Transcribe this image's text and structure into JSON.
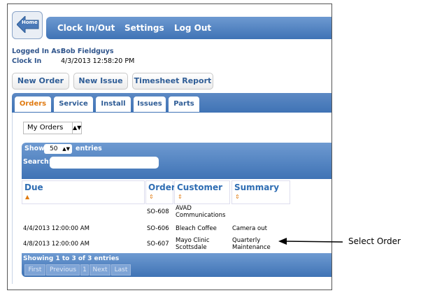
{
  "nav": {
    "home_label": "Home",
    "items": [
      "Clock In/Out",
      "Settings",
      "Log Out"
    ]
  },
  "session": {
    "logged_in_label": "Logged In As:",
    "user": "Bob Fieldguys",
    "clock_in_label": "Clock In",
    "clock_in_value": "4/3/2013 12:58:20 PM"
  },
  "actions": [
    "New Order",
    "New Issue",
    "Timesheet Report"
  ],
  "tabs": [
    "Orders",
    "Service",
    "Install",
    "Issues",
    "Parts"
  ],
  "filter": {
    "selected": "My Orders"
  },
  "table_controls": {
    "show_label": "Show",
    "entries_value": "50",
    "entries_label": "entries",
    "search_label": "Search:",
    "search_value": ""
  },
  "columns": [
    "Due",
    "Order",
    "Customer",
    "Summary"
  ],
  "rows": [
    {
      "due": "",
      "order": "SO-608",
      "customer_1": "AVAD",
      "customer_2": "Communications",
      "summary_1": "",
      "summary_2": ""
    },
    {
      "due": "4/4/2013 12:00:00 AM",
      "order": "SO-606",
      "customer_1": "Bleach Coffee",
      "customer_2": "",
      "summary_1": "Camera out",
      "summary_2": ""
    },
    {
      "due": "4/8/2013 12:00:00 AM",
      "order": "SO-607",
      "customer_1": "Mayo Clinic",
      "customer_2": "Scottsdale",
      "summary_1": "Quarterly",
      "summary_2": "Maintenance"
    }
  ],
  "footer": {
    "showing": "Showing 1 to 3 of 3 entries",
    "pager": [
      "First",
      "Previous",
      "1",
      "Next",
      "Last"
    ]
  },
  "annotation": "Select Order",
  "colors": {
    "accent": "#3f73b5",
    "active_tab": "#e07a10",
    "header_text": "#2f6db3"
  }
}
